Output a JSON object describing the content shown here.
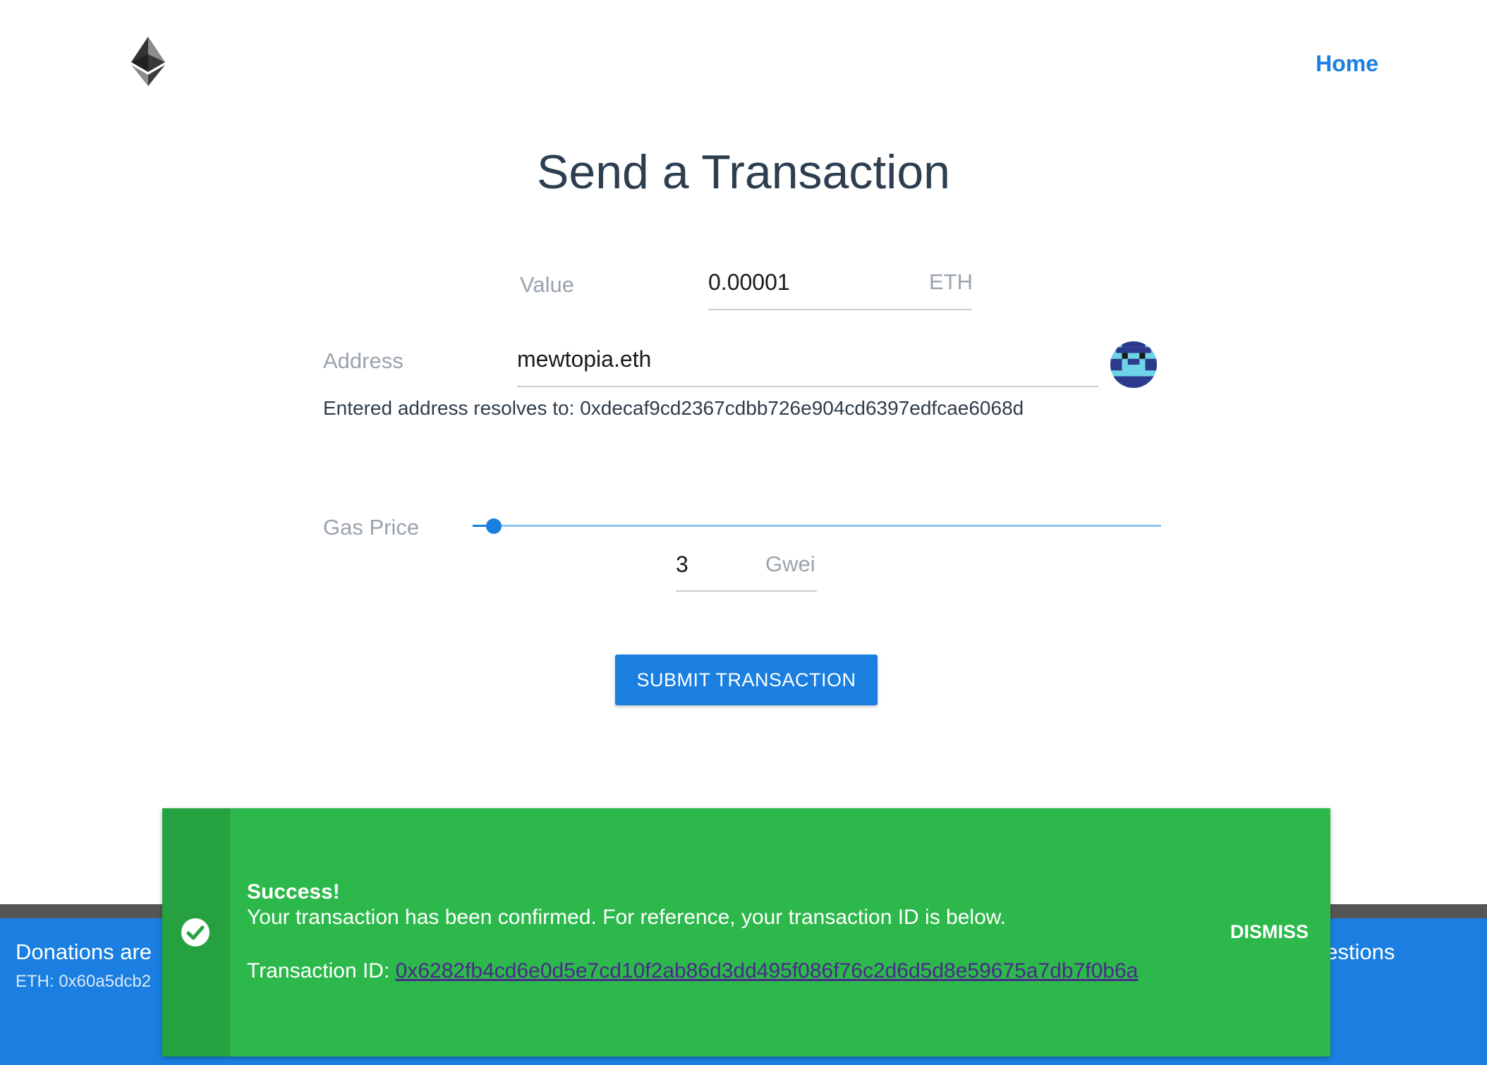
{
  "header": {
    "logo_icon": "ethereum-logo-icon",
    "nav_home": "Home"
  },
  "main": {
    "title": "Send a Transaction",
    "value": {
      "label": "Value",
      "input": "0.00001",
      "unit": "ETH"
    },
    "address": {
      "label": "Address",
      "input": "mewtopia.eth",
      "resolves_text": "Entered address resolves to: 0xdecaf9cd2367cdbb726e904cd6397edfcae6068d",
      "avatar_icon": "identicon-avatar-icon"
    },
    "gas_price": {
      "label": "Gas Price",
      "input": "3",
      "unit": "Gwei",
      "slider_level": 0.02
    },
    "submit_label": "SUBMIT TRANSACTION"
  },
  "footer": {
    "donations_text": "Donations are",
    "eth_text": "ETH: 0x60a5dcb2",
    "suggestions_text": "gestions"
  },
  "toast": {
    "icon": "check-circle-icon",
    "title": "Success!",
    "message": "Your transaction has been confirmed. For reference, your transaction ID is below.",
    "txid_label": "Transaction ID:",
    "txid_value": "0x6282fb4cd6e0d5e7cd10f2ab86d3dd495f086f76c2d6d5d8e59675a7db7f0b6a",
    "dismiss_label": "DISMISS"
  },
  "colors": {
    "accent": "#1a7fe0",
    "success": "#2db84c",
    "success_dark": "#26a13f"
  }
}
